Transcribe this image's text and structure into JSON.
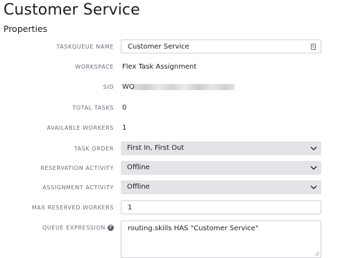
{
  "page": {
    "title": "Customer Service",
    "section": "Properties"
  },
  "fields": {
    "taskqueue_name": {
      "label": "TASKQUEUE NAME",
      "value": "Customer Service"
    },
    "workspace": {
      "label": "WORKSPACE",
      "value": "Flex Task Assignment"
    },
    "sid": {
      "label": "SID",
      "value": "WQ"
    },
    "total_tasks": {
      "label": "TOTAL TASKS",
      "value": "0"
    },
    "available_workers": {
      "label": "AVAILABLE WORKERS",
      "value": "1"
    },
    "task_order": {
      "label": "TASK ORDER",
      "value": "First In, First Out"
    },
    "reservation_activity": {
      "label": "RESERVATION ACTIVITY",
      "value": "Offline"
    },
    "assignment_activity": {
      "label": "ASSIGNMENT ACTIVITY",
      "value": "Offline"
    },
    "max_reserved_workers": {
      "label": "MAX RESERVED WORKERS",
      "value": "1"
    },
    "queue_expression": {
      "label": "QUEUE EXPRESSION",
      "value": "routing.skills HAS \"Customer Service\""
    }
  },
  "icons": {
    "help": "question-circle-icon",
    "chevron": "chevron-down-icon",
    "list": "list-icon",
    "resize": "resize-handle-icon"
  }
}
